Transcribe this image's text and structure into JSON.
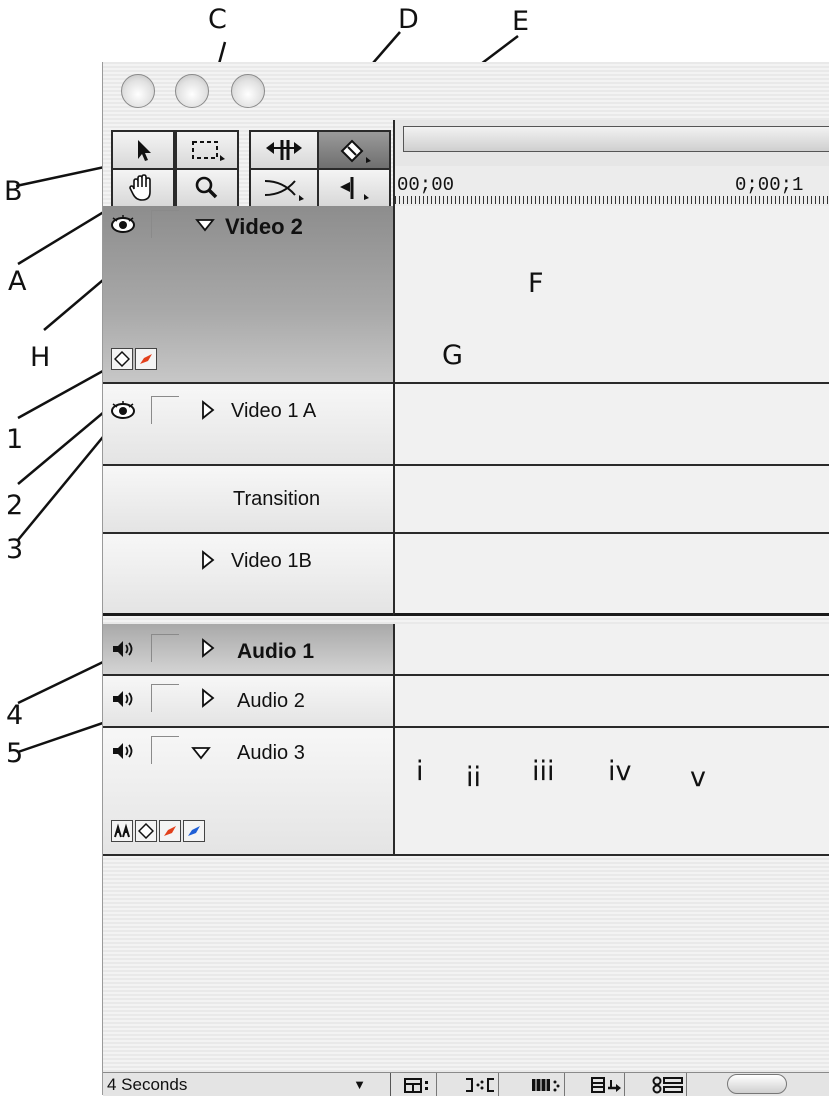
{
  "timeline": {
    "tracks": [
      {
        "label": "Video 2",
        "bold": true
      },
      {
        "label": "Video 1 A",
        "bold": false
      },
      {
        "label": "Transition",
        "bold": false
      },
      {
        "label": "Video 1B",
        "bold": false
      },
      {
        "label": "Audio 1",
        "bold": true
      },
      {
        "label": "Audio 2",
        "bold": false
      },
      {
        "label": "Audio 3",
        "bold": false
      }
    ],
    "ruler": {
      "start": "00;00",
      "mark": "0;00;1"
    },
    "zoom_select": "4 Seconds"
  },
  "tools": [
    {
      "name": "selection-tool",
      "icon": "arrow-pointer-icon"
    },
    {
      "name": "range-select-tool",
      "icon": "marquee-icon"
    },
    {
      "name": "hand-tool",
      "icon": "hand-icon"
    },
    {
      "name": "zoom-tool",
      "icon": "magnifier-icon"
    },
    {
      "name": "ripple-edit-tool",
      "icon": "ripple-edit-icon"
    },
    {
      "name": "fade-pen-tool",
      "icon": "pen-tool-icon"
    },
    {
      "name": "cross-fade-tool",
      "icon": "crossfade-icon"
    },
    {
      "name": "in-point-tool",
      "icon": "in-point-icon"
    }
  ],
  "bottom_buttons": [
    {
      "name": "track-format-button",
      "icon": "track-format-icon"
    },
    {
      "name": "toggle-shift-tracks-button",
      "icon": "shift-tracks-icon"
    },
    {
      "name": "toggle-snap-button",
      "icon": "snap-icon"
    },
    {
      "name": "edge-viewing-button",
      "icon": "edge-view-icon"
    },
    {
      "name": "sync-mode-button",
      "icon": "sync-icon"
    }
  ],
  "callouts": {
    "letters": [
      "A",
      "B",
      "C",
      "D",
      "E",
      "F",
      "G",
      "H"
    ],
    "numbers": [
      "1",
      "2",
      "3",
      "4",
      "5"
    ],
    "roman": [
      "i",
      "ii",
      "iii",
      "iv",
      "v"
    ]
  }
}
